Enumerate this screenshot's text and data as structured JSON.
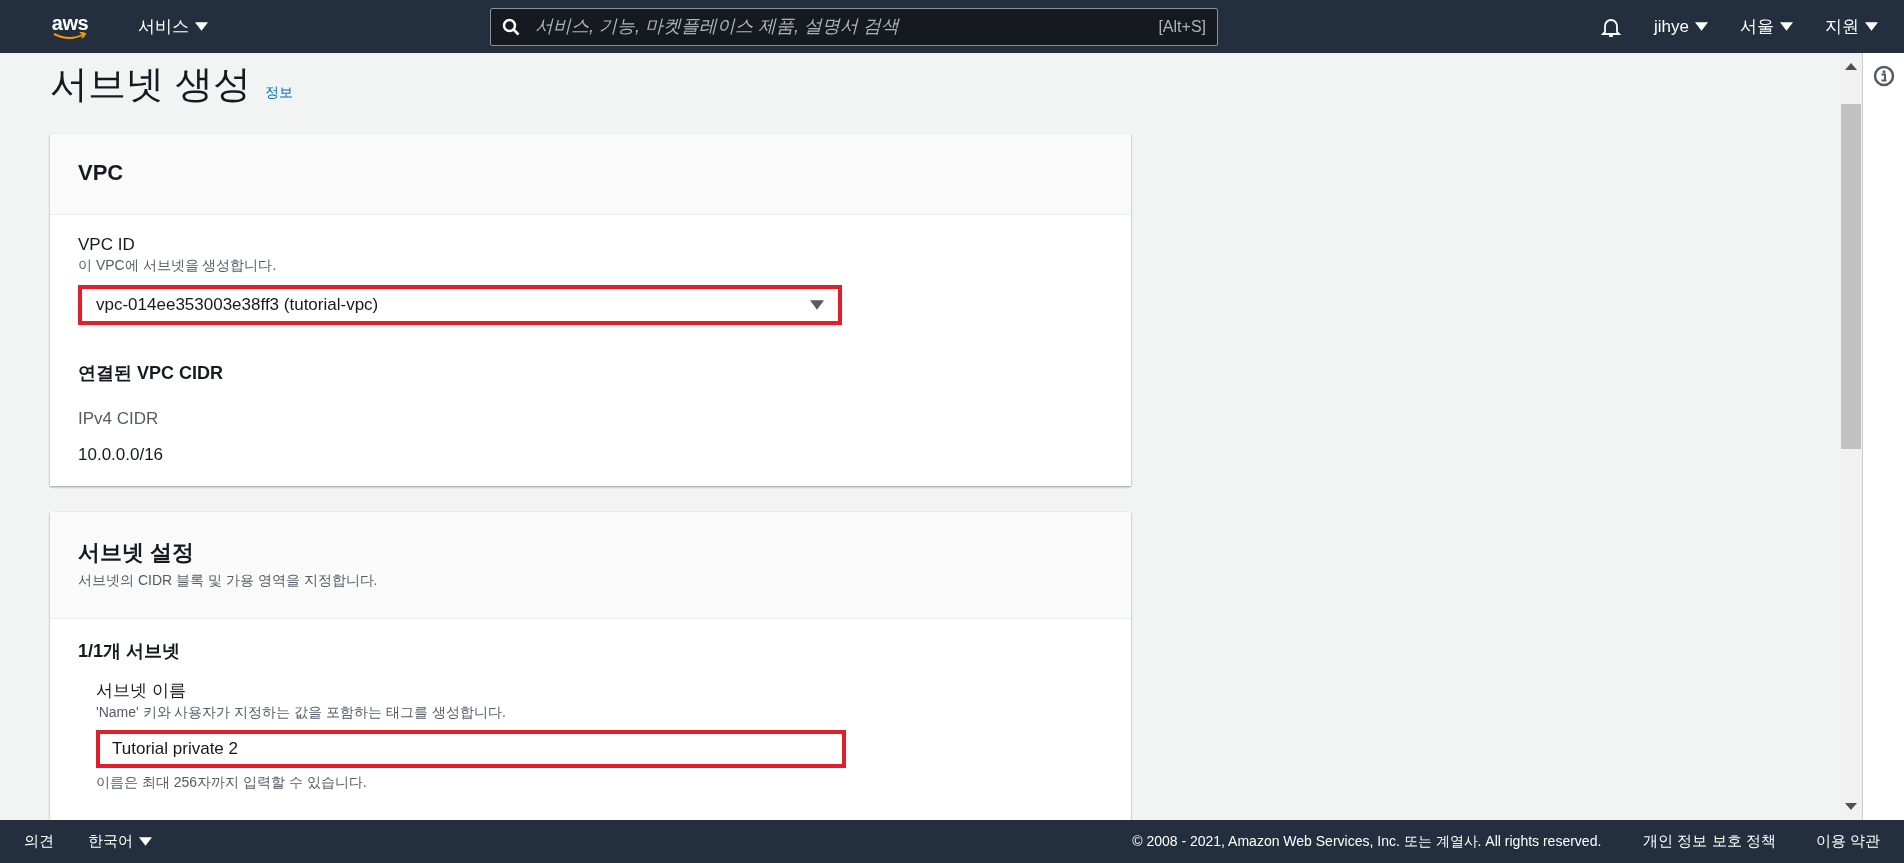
{
  "top_nav": {
    "logo": "aws",
    "services_menu": "서비스",
    "search": {
      "placeholder": "서비스, 기능, 마켓플레이스 제품, 설명서 검색",
      "shortcut": "[Alt+S]"
    },
    "user_menu": "jihye",
    "region_menu": "서울",
    "support_menu": "지원"
  },
  "page": {
    "title": "서브넷 생성",
    "info_link": "정보"
  },
  "vpc_card": {
    "title": "VPC",
    "vpc_id": {
      "label": "VPC ID",
      "description": "이 VPC에 서브넷을 생성합니다.",
      "value": "vpc-014ee353003e38ff3 (tutorial-vpc)",
      "highlighted": true
    },
    "cidr_section": {
      "title": "연결된 VPC CIDR",
      "label": "IPv4 CIDR",
      "value": "10.0.0.0/16"
    }
  },
  "subnet_card": {
    "title": "서브넷 설정",
    "description": "서브넷의 CIDR 블록 및 가용 영역을 지정합니다.",
    "subnet_count": "1/1개 서브넷",
    "name_field": {
      "label": "서브넷 이름",
      "description": "'Name' 키와 사용자가 지정하는 값을 포함하는 태그를 생성합니다.",
      "value": "Tutorial private 2",
      "hint": "이름은 최대 256자까지 입력할 수 있습니다.",
      "highlighted": true
    }
  },
  "footer": {
    "feedback": "의견",
    "language": "한국어",
    "copyright": "© 2008 - 2021, Amazon Web Services, Inc. 또는 계열사. All rights reserved.",
    "privacy": "개인 정보 보호 정책",
    "terms": "이용 약관"
  }
}
